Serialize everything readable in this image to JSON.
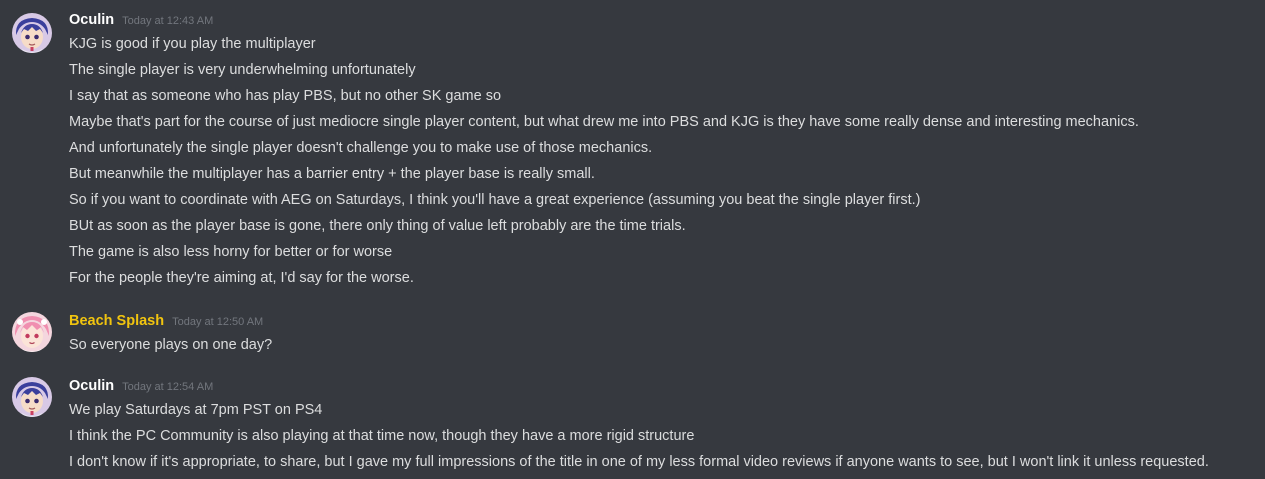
{
  "colors": {
    "background": "#36393f",
    "text": "#dcddde",
    "timestamp": "#72767d",
    "oculin_name": "#ffffff",
    "beach_splash_name": "#f1c40f"
  },
  "messages": [
    {
      "author": "Oculin",
      "author_color": "#ffffff",
      "timestamp": "Today at 12:43 AM",
      "avatar": "oculin-avatar",
      "lines": [
        "KJG is good if you play the multiplayer",
        "The single player is very underwhelming unfortunately",
        "I say that as someone who has play PBS, but no other SK game so",
        "Maybe that's part for the course of just mediocre single player content, but what drew me into PBS and KJG is they have some really dense and interesting mechanics.",
        "And unfortunately the single player doesn't challenge you to make use of those mechanics.",
        "But meanwhile the multiplayer has a barrier entry + the player base is really small.",
        "So if you want to coordinate with AEG on Saturdays, I think you'll have a great experience (assuming you beat the single player first.)",
        "BUt as soon as the player base is gone, there only thing of value left probably are the time trials.",
        "The game is also less horny for better or for worse",
        "For the people they're aiming at, I'd say for the worse."
      ]
    },
    {
      "author": "Beach Splash",
      "author_color": "#f1c40f",
      "timestamp": "Today at 12:50 AM",
      "avatar": "beach-splash-avatar",
      "lines": [
        "So everyone plays on one day?"
      ]
    },
    {
      "author": "Oculin",
      "author_color": "#ffffff",
      "timestamp": "Today at 12:54 AM",
      "avatar": "oculin-avatar",
      "lines": [
        "We play Saturdays at 7pm PST on PS4",
        "I think the PC Community is also playing at that time now, though they have a more rigid structure",
        "I don't know if it's appropriate, to share, but I gave my full impressions of the title in one of my less formal video reviews if anyone wants to see, but I won't link it unless requested."
      ]
    }
  ]
}
